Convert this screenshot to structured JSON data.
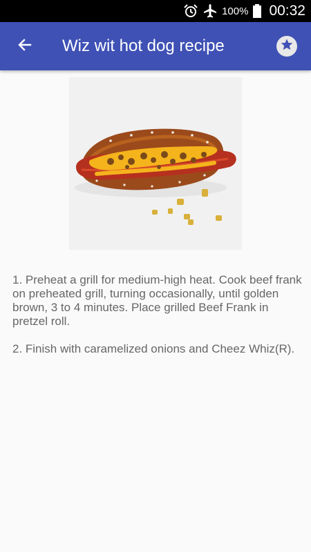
{
  "status_bar": {
    "icons": [
      "alarm-icon",
      "airplane-mode-icon",
      "battery-icon"
    ],
    "battery_percent": "100%",
    "time": "00:32"
  },
  "app_bar": {
    "title": "Wiz wit hot dog recipe",
    "back_icon": "arrow-back-icon",
    "favorite_icon": "star-icon",
    "color": "#3f51b5"
  },
  "recipe": {
    "image": "hot-dog-photo",
    "steps": [
      "1. Preheat a grill for medium-high heat. Cook beef frank on preheated grill, turning occasionally, until golden brown, 3 to 4 minutes. Place grilled Beef Frank in pretzel roll.",
      "2. Finish with caramelized onions and Cheez Whiz(R)."
    ]
  }
}
